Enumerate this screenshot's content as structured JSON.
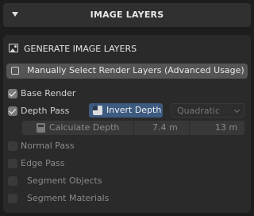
{
  "header": {
    "title": "IMAGE LAYERS"
  },
  "panel": {
    "generate_label": "GENERATE IMAGE LAYERS",
    "manual_select_label": "Manually Select Render Layers (Advanced Usage)",
    "base_render": {
      "label": "Base Render",
      "checked": true
    },
    "depth_pass": {
      "label": "Depth Pass",
      "checked": true,
      "invert_label": "Invert Depth",
      "curve_value": "Quadratic",
      "calculate_label": "Calculate Depth",
      "near_value": "7.4 m",
      "far_value": "13 m"
    },
    "normal_pass": {
      "label": "Normal Pass",
      "checked": false
    },
    "edge_pass": {
      "label": "Edge Pass",
      "checked": false
    },
    "segment_objects": {
      "label": "Segment Objects",
      "checked": false
    },
    "segment_materials": {
      "label": "Segment Materials",
      "checked": false
    }
  },
  "icons": {
    "collapse": "triangle-down-icon",
    "generate": "image-icon",
    "invert": "invert-icon",
    "calculate": "calculator-icon"
  },
  "colors": {
    "accent": "#3d5a80",
    "panel_bg": "#2a2a2a",
    "page_bg": "#1d1d1d"
  }
}
